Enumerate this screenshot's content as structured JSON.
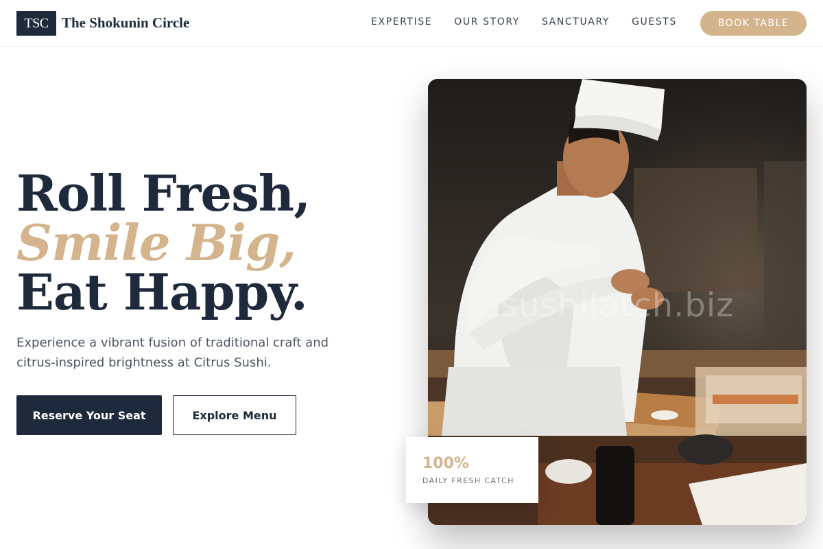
{
  "header": {
    "logo_text": "TSC",
    "brand_name": "The Shokunin Circle",
    "nav": [
      "EXPERTISE",
      "OUR STORY",
      "SANCTUARY",
      "GUESTS"
    ],
    "book_label": "BOOK TABLE"
  },
  "hero": {
    "line1": "Roll Fresh,",
    "line2": "Smile Big,",
    "line3": "Eat Happy.",
    "subtitle": "Experience a vibrant fusion of traditional craft and citrus-inspired brightness at Citrus Sushi.",
    "primary_cta": "Reserve Your Seat",
    "secondary_cta": "Explore Menu"
  },
  "photo": {
    "watermark": "sushilatch.biz"
  },
  "stat": {
    "value": "100%",
    "label": "DAILY FRESH CATCH"
  },
  "colors": {
    "navy": "#1e293b",
    "gold": "#d4b48c"
  }
}
